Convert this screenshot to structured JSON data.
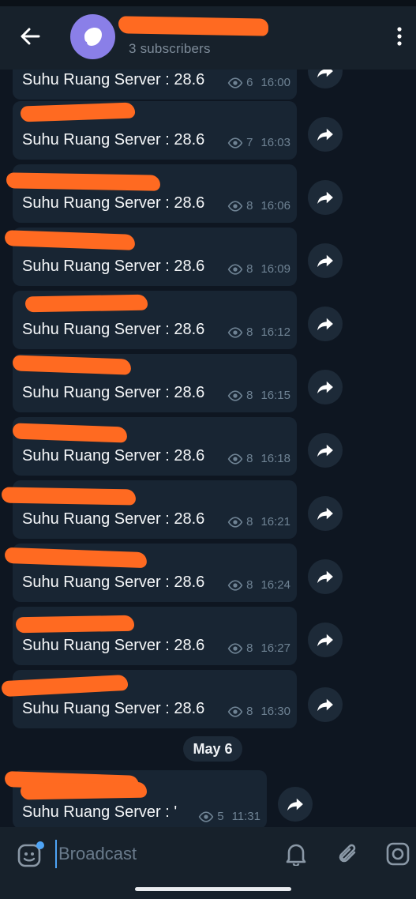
{
  "header": {
    "subscribers": "3 subscribers"
  },
  "messages": [
    {
      "text": "Suhu Ruang Server : 28.6",
      "views": "6",
      "time": "16:00"
    },
    {
      "text": "Suhu Ruang Server : 28.6",
      "views": "7",
      "time": "16:03"
    },
    {
      "text": "Suhu Ruang Server : 28.6",
      "views": "8",
      "time": "16:06"
    },
    {
      "text": "Suhu Ruang Server : 28.6",
      "views": "8",
      "time": "16:09"
    },
    {
      "text": "Suhu Ruang Server : 28.6",
      "views": "8",
      "time": "16:12"
    },
    {
      "text": "Suhu Ruang Server : 28.6",
      "views": "8",
      "time": "16:15"
    },
    {
      "text": "Suhu Ruang Server : 28.6",
      "views": "8",
      "time": "16:18"
    },
    {
      "text": "Suhu Ruang Server : 28.6",
      "views": "8",
      "time": "16:21"
    },
    {
      "text": "Suhu Ruang Server : 28.6",
      "views": "8",
      "time": "16:24"
    },
    {
      "text": "Suhu Ruang Server : 28.6",
      "views": "8",
      "time": "16:27"
    },
    {
      "text": "Suhu Ruang Server : 28.6",
      "views": "8",
      "time": "16:30"
    },
    {
      "text": "Suhu Ruang Server : '",
      "views": "5",
      "time": "11:31"
    }
  ],
  "date_separator": "May 6",
  "composer": {
    "placeholder": "Broadcast"
  },
  "colors": {
    "background": "#0e1621",
    "header": "#17212b",
    "bubble": "#182533",
    "redaction": "#ff6a21",
    "accent": "#4ea4f6",
    "avatar": "#8a7fe8"
  },
  "icons": [
    "back-arrow-icon",
    "channel-avatar-icon",
    "more-vert-icon",
    "eye-icon",
    "forward-icon",
    "sticker-icon",
    "bell-icon",
    "paperclip-icon",
    "camera-icon"
  ]
}
